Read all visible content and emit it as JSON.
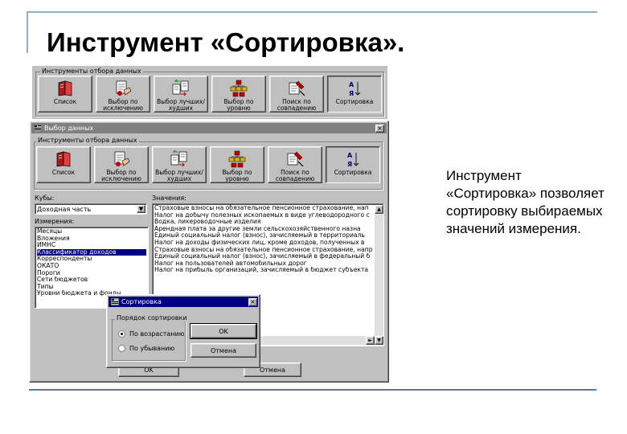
{
  "slide": {
    "title": "Инструмент «Сортировка».",
    "description": "Инструмент «Сортировка» позволяет сортировку выбираемых значений измерения."
  },
  "colors": {
    "titlebar_active": "#000080",
    "titlebar_inactive": "#808080",
    "face": "#c0c0c0",
    "accent_line": "#4e7fa8"
  },
  "top_toolbar": {
    "legend": "Инструменты отбора данных",
    "buttons": [
      {
        "label": "Список",
        "icon": "book-icon"
      },
      {
        "label": "Выбор по исключению",
        "icon": "document-hand-icon"
      },
      {
        "label": "Выбор лучших/худших",
        "icon": "documents-arrows-icon"
      },
      {
        "label": "Выбор по уровню",
        "icon": "hierarchy-icon"
      },
      {
        "label": "Поиск по совпадению",
        "icon": "search-pencil-icon"
      },
      {
        "label": "Сортировка",
        "icon": "sort-az-icon"
      }
    ]
  },
  "dialog": {
    "title": "Выбор данных",
    "close": "×",
    "toolbar_legend": "Инструменты отбора данных",
    "buttons": [
      {
        "label": "Список",
        "icon": "book-icon"
      },
      {
        "label": "Выбор по исключению",
        "icon": "document-hand-icon"
      },
      {
        "label": "Выбор лучших/худших",
        "icon": "documents-arrows-icon"
      },
      {
        "label": "Выбор по уровню",
        "icon": "hierarchy-icon"
      },
      {
        "label": "Поиск по совпадению",
        "icon": "search-pencil-icon"
      },
      {
        "label": "Сортировка",
        "icon": "sort-az-icon"
      }
    ],
    "cubes_label": "Кубы:",
    "cube_value": "Доходная часть",
    "dimensions_label": "Измерения:",
    "dimensions": [
      "Месяцы",
      "Вложения",
      "ИМНС",
      "Классификатор доходов",
      "Корреспонденты",
      "ОКАТО",
      "Пороги",
      "Сети бюджетов",
      "Типы",
      "Уровни бюджета и фонды"
    ],
    "selected_dimension_index": 3,
    "values_label": "Значения:",
    "values": [
      "Страховые взносы на обязательное пенсионное страхование, нап",
      "Налог на добычу полезных ископаемых в виде углеводородного с",
      "Водка, ликероводочные изделия",
      "Арендная плата за другие земли сельскохозяйственного назна",
      "Единый социальный налог (взнос), зачисляемый в территориаль",
      "Налог на доходы физических лиц, кроме доходов, полученных в",
      "Страховые взносы на обязательное пенсионное страхование, напра",
      "Единый социальный налог (взнос), зачисляемый в федеральный б",
      "Налог на пользователей автомобильных дорог",
      "Налог на прибыль организаций, зачисляемый в бюджет субъекта"
    ],
    "ok": "OK",
    "cancel": "Отмена"
  },
  "sort_dialog": {
    "title": "Сортировка",
    "close": "×",
    "legend": "Порядок сортировки",
    "options": [
      "По возрастанию",
      "По убыванию"
    ],
    "selected_option_index": 0,
    "ok": "OK",
    "cancel": "Отмена"
  }
}
